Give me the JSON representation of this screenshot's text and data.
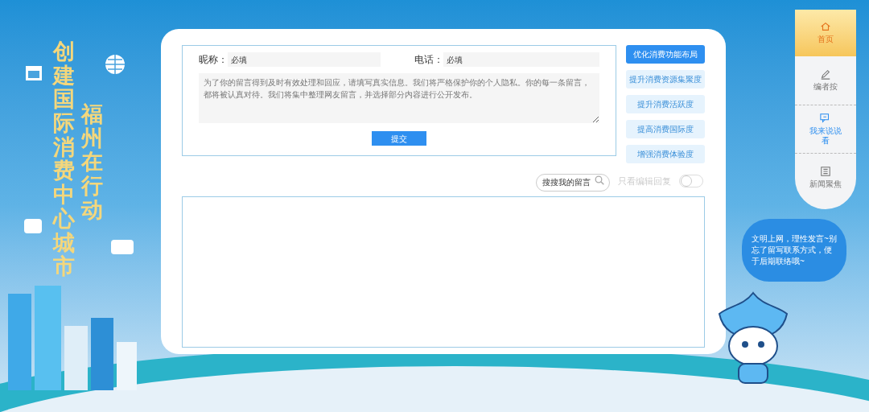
{
  "banner": {
    "title": "创建国际消费中心城市",
    "subtitle": "福州在行动"
  },
  "form": {
    "nickname": {
      "label": "昵称：",
      "placeholder": "必填"
    },
    "phone": {
      "label": "电话：",
      "placeholder": "必填"
    },
    "message": {
      "placeholder": "为了你的留言得到及时有效处理和回应，请填写真实信息。我们将严格保护你的个人隐私。你的每一条留言，都将被认真对待。我们将集中整理网友留言，并选择部分内容进行公开发布。"
    },
    "submit": "提交"
  },
  "topics": [
    {
      "label": "优化消费功能布局",
      "selected": true
    },
    {
      "label": "提升消费资源集聚度",
      "selected": false
    },
    {
      "label": "提升消费活跃度",
      "selected": false
    },
    {
      "label": "提高消费国际度",
      "selected": false
    },
    {
      "label": "增强消费体验度",
      "selected": false
    }
  ],
  "search": {
    "placeholder": "搜搜我的留言"
  },
  "filter": {
    "label": "只看编辑回复",
    "on": false
  },
  "nav": [
    {
      "label": "首页",
      "selected": true
    },
    {
      "label": "编者按",
      "selected": false
    },
    {
      "label": "我来说说看",
      "selected": false
    },
    {
      "label": "新闻聚焦",
      "selected": false
    }
  ],
  "bubble": "文明上网，理性发言~别忘了留写联系方式，便于后期联络哦~"
}
